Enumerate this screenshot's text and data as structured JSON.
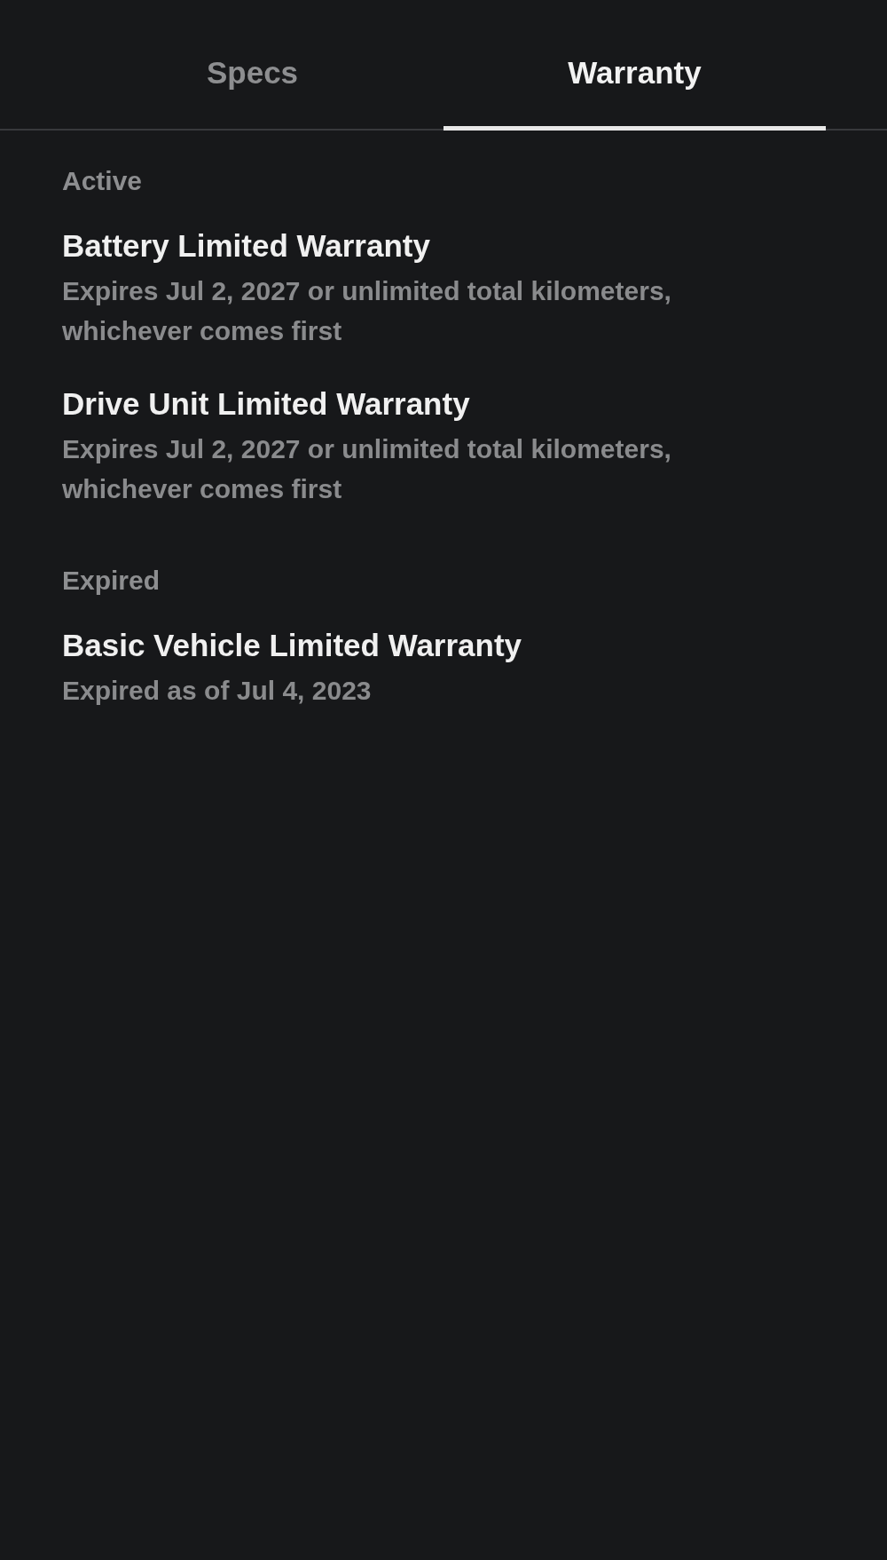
{
  "tabs": [
    {
      "label": "Specs",
      "selected": false
    },
    {
      "label": "Warranty",
      "selected": true
    }
  ],
  "sections": [
    {
      "heading": "Active",
      "items": [
        {
          "title": "Battery Limited Warranty",
          "detail": "Expires Jul 2, 2027 or unlimited total kilometers, whichever comes first"
        },
        {
          "title": "Drive Unit Limited Warranty",
          "detail": "Expires Jul 2, 2027 or unlimited total kilometers, whichever comes first"
        }
      ]
    },
    {
      "heading": "Expired",
      "items": [
        {
          "title": "Basic Vehicle Limited Warranty",
          "detail": "Expired as of Jul 4, 2023"
        }
      ]
    }
  ]
}
